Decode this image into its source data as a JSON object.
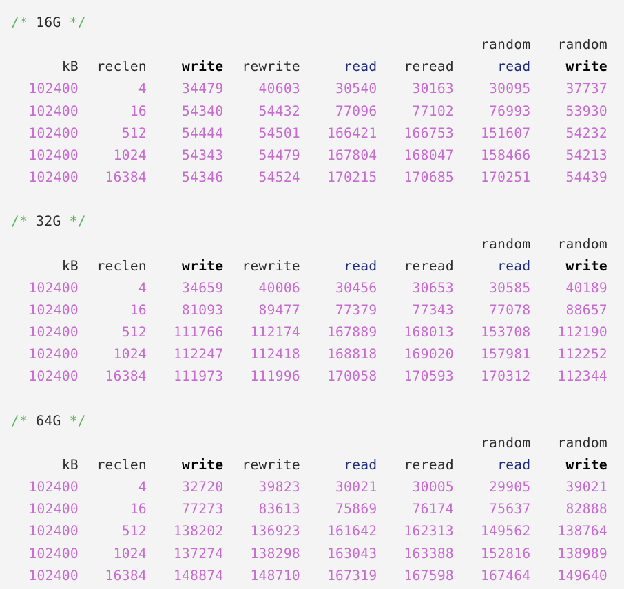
{
  "sections": [
    {
      "comment_open": "/*",
      "comment_label": "16G",
      "comment_close": "*/",
      "header_top": [
        "",
        "",
        "",
        "",
        "",
        "",
        "random",
        "random"
      ],
      "header": [
        "kB",
        "reclen",
        "write",
        "rewrite",
        "read",
        "reread",
        "read",
        "write"
      ],
      "rows": [
        [
          "102400",
          "4",
          "34479",
          "40603",
          "30540",
          "30163",
          "30095",
          "37737"
        ],
        [
          "102400",
          "16",
          "54340",
          "54432",
          "77096",
          "77102",
          "76993",
          "53930"
        ],
        [
          "102400",
          "512",
          "54444",
          "54501",
          "166421",
          "166753",
          "151607",
          "54232"
        ],
        [
          "102400",
          "1024",
          "54343",
          "54479",
          "167804",
          "168047",
          "158466",
          "54213"
        ],
        [
          "102400",
          "16384",
          "54346",
          "54524",
          "170215",
          "170685",
          "170251",
          "54439"
        ]
      ]
    },
    {
      "comment_open": "/*",
      "comment_label": "32G",
      "comment_close": "*/",
      "header_top": [
        "",
        "",
        "",
        "",
        "",
        "",
        "random",
        "random"
      ],
      "header": [
        "kB",
        "reclen",
        "write",
        "rewrite",
        "read",
        "reread",
        "read",
        "write"
      ],
      "rows": [
        [
          "102400",
          "4",
          "34659",
          "40006",
          "30456",
          "30653",
          "30585",
          "40189"
        ],
        [
          "102400",
          "16",
          "81093",
          "89477",
          "77379",
          "77343",
          "77078",
          "88657"
        ],
        [
          "102400",
          "512",
          "111766",
          "112174",
          "167889",
          "168013",
          "153708",
          "112190"
        ],
        [
          "102400",
          "1024",
          "112247",
          "112418",
          "168818",
          "169020",
          "157981",
          "112252"
        ],
        [
          "102400",
          "16384",
          "111973",
          "111996",
          "170058",
          "170593",
          "170312",
          "112344"
        ]
      ]
    },
    {
      "comment_open": "/*",
      "comment_label": "64G",
      "comment_close": "*/",
      "header_top": [
        "",
        "",
        "",
        "",
        "",
        "",
        "random",
        "random"
      ],
      "header": [
        "kB",
        "reclen",
        "write",
        "rewrite",
        "read",
        "reread",
        "read",
        "write"
      ],
      "rows": [
        [
          "102400",
          "4",
          "32720",
          "39823",
          "30021",
          "30005",
          "29905",
          "39021"
        ],
        [
          "102400",
          "16",
          "77273",
          "83613",
          "75869",
          "76174",
          "75637",
          "82888"
        ],
        [
          "102400",
          "512",
          "138202",
          "136923",
          "161642",
          "162313",
          "149562",
          "138764"
        ],
        [
          "102400",
          "1024",
          "137274",
          "138298",
          "163043",
          "163388",
          "152816",
          "138989"
        ],
        [
          "102400",
          "16384",
          "148874",
          "148710",
          "167319",
          "167598",
          "167464",
          "149640"
        ]
      ]
    }
  ]
}
